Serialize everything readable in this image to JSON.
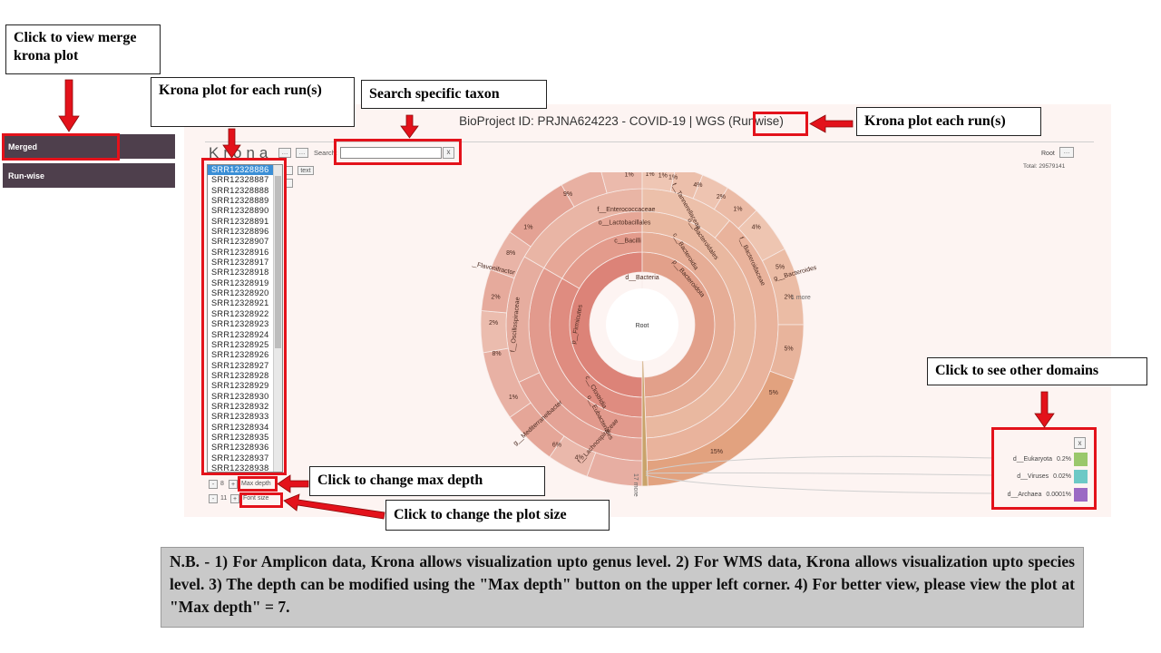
{
  "sidebar": {
    "merged_label": "Merged",
    "runwise_label": "Run-wise"
  },
  "callouts": {
    "merge": "Click to view merge krona plot",
    "per_run": "Krona plot for each run(s)",
    "search": "Search specific taxon",
    "each_run": "Krona plot each run(s)",
    "domains": "Click to see other domains",
    "max_depth": "Click to change max depth",
    "plot_size": "Click to change the plot size"
  },
  "krona": {
    "title": "BioProject ID: PRJNA624223 - COVID-19 | WGS",
    "title_mode": "(Runwise)",
    "logo": "Krona",
    "search_label": "Search:",
    "search_value": "",
    "clear_label": "x",
    "root_label": "Root",
    "total_label": "Total: 29579141",
    "center_label": "Root",
    "max_depth_value": "8",
    "max_depth_label": "Max depth",
    "font_size_value": "11",
    "font_size_label": "Font size",
    "minus": "-",
    "plus": "+",
    "more_label": "1 more",
    "tail_label": "17 more",
    "runs": [
      "SRR12328886",
      "SRR12328887",
      "SRR12328888",
      "SRR12328889",
      "SRR12328890",
      "SRR12328891",
      "SRR12328896",
      "SRR12328907",
      "SRR12328916",
      "SRR12328917",
      "SRR12328918",
      "SRR12328919",
      "SRR12328920",
      "SRR12328921",
      "SRR12328922",
      "SRR12328923",
      "SRR12328924",
      "SRR12328925",
      "SRR12328926",
      "SRR12328927",
      "SRR12328928",
      "SRR12328929",
      "SRR12328930",
      "SRR12328932",
      "SRR12328933",
      "SRR12328934",
      "SRR12328935",
      "SRR12328936",
      "SRR12328937",
      "SRR12328938"
    ],
    "labels": {
      "bacteria": "d__Bacteria",
      "firmicutes": "p__Firmicutes",
      "clostridia": "c__Clostridia",
      "eubacteriales": "o__Eubacteriales",
      "lachnospiraceae": "f__Lachnospiraceae",
      "oscillospiraceae": "f__Oscillospiraceae",
      "bacilli": "c__Bacilli",
      "lactobacillales": "o__Lactobacillales",
      "enterococcaceae": "f__Enterococcaceae",
      "bacteroidota": "p__Bacteroidota",
      "bacteroidia": "c__Bacteroidia",
      "bacteroidales": "o__Bacteroidales",
      "tannerellaceae": "f__Tannerellaceae",
      "bacteroidaceae": "f__Bacteroidaceae",
      "bacteroides": "g__Bacteroides",
      "flavonifractor": "g__Flavonifractor",
      "mediterraneibacter": "g__Mediterraneibacter"
    },
    "pct": [
      "1%",
      "1%",
      "1%",
      "1%",
      "9%",
      "4%",
      "2%",
      "1%",
      "4%",
      "5%",
      "2%",
      "5%",
      "5%",
      "15%",
      "4%",
      "6%",
      "1%",
      "8%",
      "2%",
      "2%",
      "8%",
      "1%"
    ],
    "domains_close": "x",
    "domains": [
      {
        "name": "d__Eukaryota",
        "pct": "0.2%",
        "color": "#9ac86c"
      },
      {
        "name": "d__Viruses",
        "pct": "0.02%",
        "color": "#6cc9c6"
      },
      {
        "name": "d__Archaea",
        "pct": "0.0001%",
        "color": "#9b6ac4"
      }
    ]
  },
  "note": "N.B. - 1) For Amplicon data, Krona allows visualization upto genus level. 2) For WMS data, Krona allows visualization upto species level. 3) The depth can be modified using the \"Max depth\" button on the upper left corner. 4) For better view, please view the plot at \"Max depth\" = 7."
}
